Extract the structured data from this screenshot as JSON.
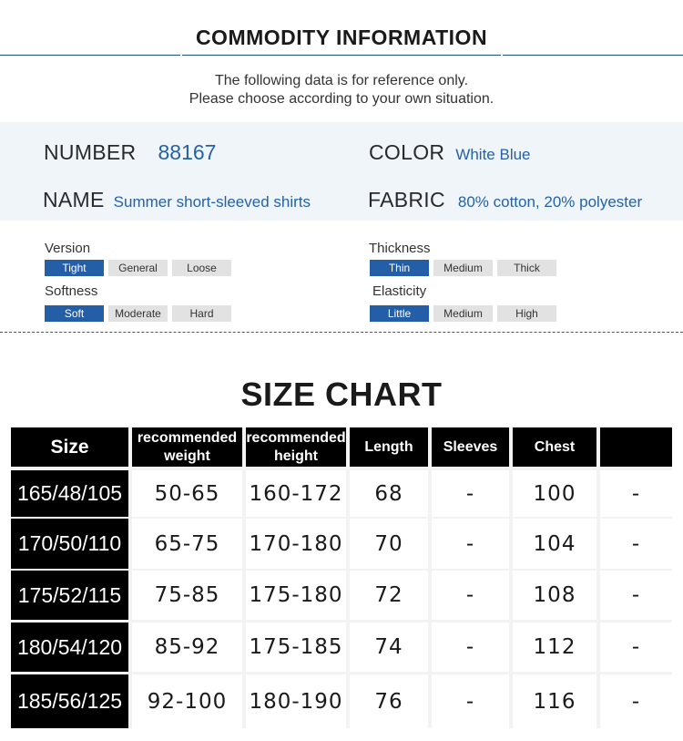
{
  "header": {
    "title": "COMMODITY INFORMATION",
    "note_line1": "The following data is for reference only.",
    "note_line2": "Please choose according to your own situation."
  },
  "info": {
    "number_label": "NUMBER",
    "number_value": "88167",
    "color_label": "COLOR",
    "color_value": "White Blue",
    "name_label": "NAME",
    "name_value": "Summer short-sleeved shirts",
    "fabric_label": "FABRIC",
    "fabric_value": "80% cotton, 20% polyester"
  },
  "attributes": [
    {
      "label": "Version",
      "options": [
        "Tight",
        "General",
        "Loose"
      ],
      "selected": "Tight"
    },
    {
      "label": "Thickness",
      "options": [
        "Thin",
        "Medium",
        "Thick"
      ],
      "selected": "Thin"
    },
    {
      "label": "Softness",
      "options": [
        "Soft",
        "Moderate",
        "Hard"
      ],
      "selected": "Soft"
    },
    {
      "label": "Elasticity",
      "options": [
        "Little",
        "Medium",
        "High"
      ],
      "selected": "Little"
    }
  ],
  "size_chart": {
    "title": "SIZE CHART",
    "headers": [
      "Size",
      "recommended weight",
      "recommended height",
      "Length",
      "Sleeves",
      "Chest",
      ""
    ],
    "rows": [
      [
        "165/48/105",
        "50-65",
        "160-172",
        "68",
        "-",
        "100",
        "-"
      ],
      [
        "170/50/110",
        "65-75",
        "170-180",
        "70",
        "-",
        "104",
        "-"
      ],
      [
        "175/52/115",
        "75-85",
        "175-180",
        "72",
        "-",
        "108",
        "-"
      ],
      [
        "180/54/120",
        "85-92",
        "175-185",
        "74",
        "-",
        "112",
        "-"
      ],
      [
        "185/56/125",
        "92-100",
        "180-190",
        "76",
        "-",
        "116",
        "-"
      ]
    ]
  },
  "colors": {
    "accent_blue": "#245ea6",
    "value_blue": "#2462a8",
    "info_band": "#f0f5fa"
  }
}
